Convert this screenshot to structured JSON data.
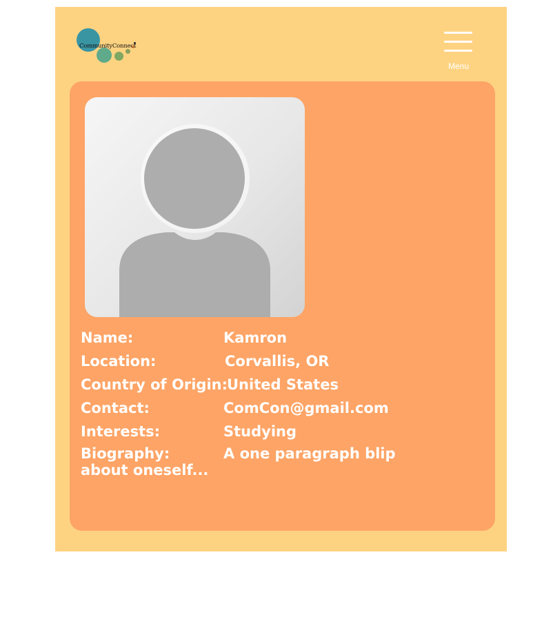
{
  "brand": {
    "logo_text": "CommunityConnect",
    "colors": {
      "page_bg": "#fdd382",
      "card_bg": "#fda466",
      "text": "#ffffff",
      "logo_teal": "#3a95a3",
      "logo_green": "#5faa8a",
      "logo_olive": "#8aa05c",
      "logo_orange": "#e3813a"
    }
  },
  "header": {
    "menu_label": "Menu",
    "menu_icon": "hamburger-icon"
  },
  "profile": {
    "avatar_icon": "default-user-avatar",
    "fields": [
      {
        "label": "Name:",
        "value": "Kamron"
      },
      {
        "label": "Location:",
        "value": "Corvallis, OR"
      },
      {
        "label": "Country of Origin:",
        "value": "United States"
      },
      {
        "label": "Contact:",
        "value": "ComCon@gmail.com"
      },
      {
        "label": "Interests:",
        "value": "Studying"
      }
    ],
    "biography": {
      "label": "Biography:",
      "value": "A one paragraph blip about oneself..."
    }
  }
}
